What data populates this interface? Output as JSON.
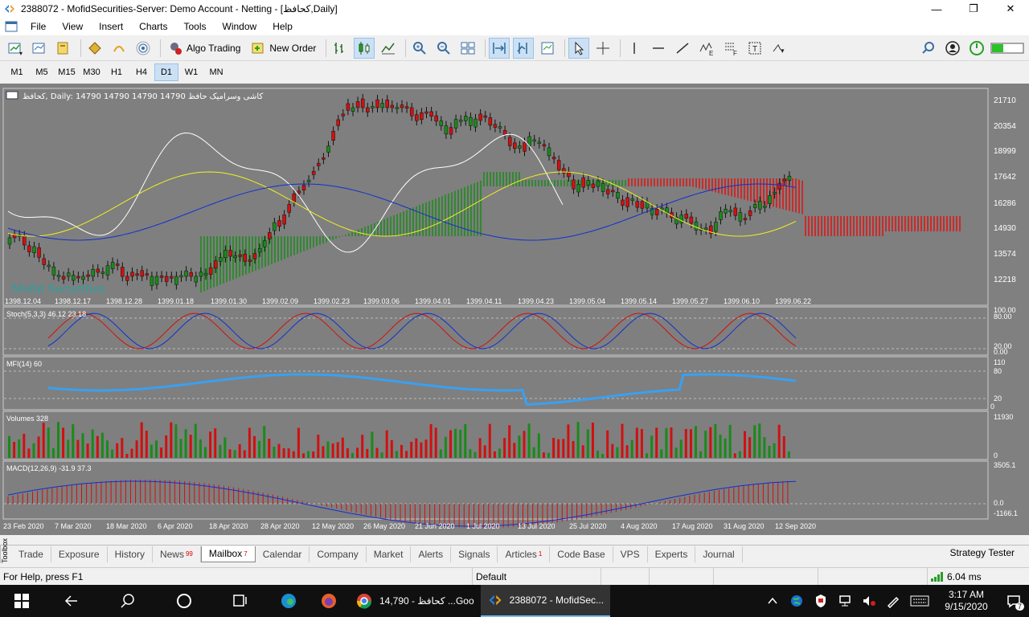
{
  "window": {
    "title": "2388072 - MofidSecurities-Server: Demo Account - Netting - [کحافظ,Daily]"
  },
  "menu": [
    "File",
    "View",
    "Insert",
    "Charts",
    "Tools",
    "Window",
    "Help"
  ],
  "toolbar": {
    "algo_trading": "Algo Trading",
    "new_order": "New Order"
  },
  "timeframes": [
    "M1",
    "M5",
    "M15",
    "M30",
    "H1",
    "H4",
    "D1",
    "W1",
    "MN"
  ],
  "active_timeframe": "D1",
  "chart": {
    "header": "کحافظ, Daily:  14790 14790 14790 14790  کاشی وسرامیک حافظ",
    "watermark": "Mofid Securities",
    "price_labels": [
      "21710",
      "20354",
      "18999",
      "17642",
      "16286",
      "14930",
      "13574",
      "12218"
    ],
    "ichimoku_dates": [
      "1398.12.04",
      "1398.12.17",
      "1398.12.28",
      "1399.01.18",
      "1399.01.30",
      "1399.02.09",
      "1399.02.23",
      "1399.03.06",
      "1399.04.01",
      "1399.04.11",
      "1399.04.23",
      "1399.05.04",
      "1399.05.14",
      "1399.05.27",
      "1399.06.10",
      "1399.06.22"
    ],
    "stoch_label": "Stoch(5,3,3) 46.12 23.18",
    "stoch_levels": [
      "100.00",
      "80.00",
      "20.00",
      "0.00"
    ],
    "mfi_label": "MFI(14) 60",
    "mfi_levels": [
      "110",
      "80",
      "20",
      "0"
    ],
    "volumes_label": "Volumes 328",
    "volume_levels": [
      "11930",
      "0"
    ],
    "macd_label": "MACD(12,26,9) -31.9 37.3",
    "macd_levels": [
      "3505.1",
      "0.0",
      "-1166.1"
    ],
    "bottom_dates": [
      "23 Feb 2020",
      "7 Mar 2020",
      "18 Mar 2020",
      "6 Apr 2020",
      "18 Apr 2020",
      "28 Apr 2020",
      "12 May 2020",
      "26 May 2020",
      "21 Jun 2020",
      "1 Jul 2020",
      "13 Jul 2020",
      "25 Jul 2020",
      "4 Aug 2020",
      "17 Aug 2020",
      "31 Aug 2020",
      "12 Sep 2020"
    ]
  },
  "tabs": [
    {
      "label": "Trade"
    },
    {
      "label": "Exposure"
    },
    {
      "label": "History"
    },
    {
      "label": "News",
      "badge": "99"
    },
    {
      "label": "Mailbox",
      "badge": "7"
    },
    {
      "label": "Calendar"
    },
    {
      "label": "Company"
    },
    {
      "label": "Market"
    },
    {
      "label": "Alerts"
    },
    {
      "label": "Signals"
    },
    {
      "label": "Articles",
      "badge": "1"
    },
    {
      "label": "Code Base"
    },
    {
      "label": "VPS"
    },
    {
      "label": "Experts"
    },
    {
      "label": "Journal"
    }
  ],
  "toolbox_label": "Toolbox",
  "active_tab": "Mailbox",
  "strategy_tester": "Strategy Tester",
  "status": {
    "help": "For Help, press F1",
    "profile": "Default",
    "ping": "6.04 ms"
  },
  "taskbar": {
    "chrome_label": "کحافظ - 14,790 ...Goo",
    "mt5_label": "2388072 - MofidSec...",
    "time": "3:17 AM",
    "date": "9/15/2020",
    "notif_count": "7"
  }
}
